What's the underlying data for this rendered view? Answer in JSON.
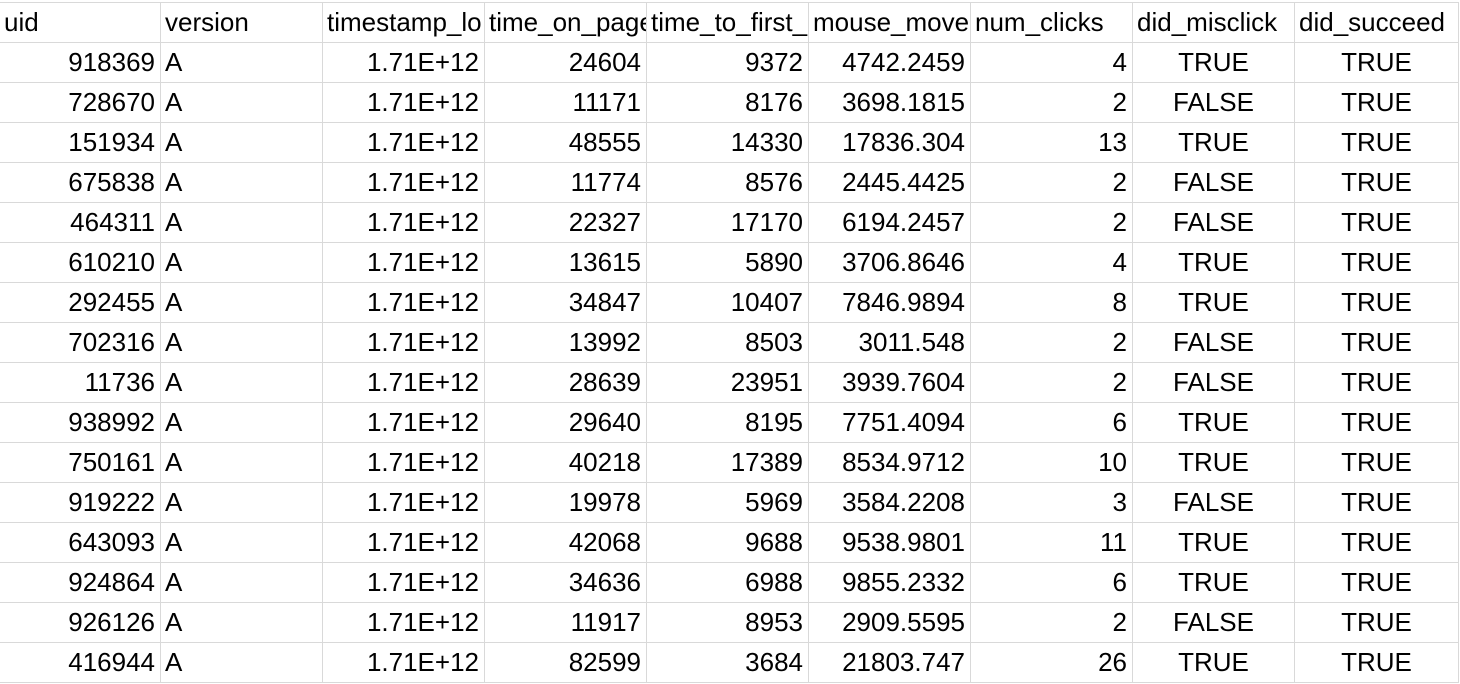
{
  "sheet": {
    "headers": [
      "uid",
      "version",
      "timestamp_lo",
      "time_on_page",
      "time_to_first_",
      "mouse_move",
      "num_clicks",
      "did_misclick",
      "did_succeed"
    ],
    "rows": [
      [
        "918369",
        "A",
        "1.71E+12",
        "24604",
        "9372",
        "4742.2459",
        "4",
        "TRUE",
        "TRUE"
      ],
      [
        "728670",
        "A",
        "1.71E+12",
        "11171",
        "8176",
        "3698.1815",
        "2",
        "FALSE",
        "TRUE"
      ],
      [
        "151934",
        "A",
        "1.71E+12",
        "48555",
        "14330",
        "17836.304",
        "13",
        "TRUE",
        "TRUE"
      ],
      [
        "675838",
        "A",
        "1.71E+12",
        "11774",
        "8576",
        "2445.4425",
        "2",
        "FALSE",
        "TRUE"
      ],
      [
        "464311",
        "A",
        "1.71E+12",
        "22327",
        "17170",
        "6194.2457",
        "2",
        "FALSE",
        "TRUE"
      ],
      [
        "610210",
        "A",
        "1.71E+12",
        "13615",
        "5890",
        "3706.8646",
        "4",
        "TRUE",
        "TRUE"
      ],
      [
        "292455",
        "A",
        "1.71E+12",
        "34847",
        "10407",
        "7846.9894",
        "8",
        "TRUE",
        "TRUE"
      ],
      [
        "702316",
        "A",
        "1.71E+12",
        "13992",
        "8503",
        "3011.548",
        "2",
        "FALSE",
        "TRUE"
      ],
      [
        "11736",
        "A",
        "1.71E+12",
        "28639",
        "23951",
        "3939.7604",
        "2",
        "FALSE",
        "TRUE"
      ],
      [
        "938992",
        "A",
        "1.71E+12",
        "29640",
        "8195",
        "7751.4094",
        "6",
        "TRUE",
        "TRUE"
      ],
      [
        "750161",
        "A",
        "1.71E+12",
        "40218",
        "17389",
        "8534.9712",
        "10",
        "TRUE",
        "TRUE"
      ],
      [
        "919222",
        "A",
        "1.71E+12",
        "19978",
        "5969",
        "3584.2208",
        "3",
        "FALSE",
        "TRUE"
      ],
      [
        "643093",
        "A",
        "1.71E+12",
        "42068",
        "9688",
        "9538.9801",
        "11",
        "TRUE",
        "TRUE"
      ],
      [
        "924864",
        "A",
        "1.71E+12",
        "34636",
        "6988",
        "9855.2332",
        "6",
        "TRUE",
        "TRUE"
      ],
      [
        "926126",
        "A",
        "1.71E+12",
        "11917",
        "8953",
        "2909.5595",
        "2",
        "FALSE",
        "TRUE"
      ],
      [
        "416944",
        "A",
        "1.71E+12",
        "82599",
        "3684",
        "21803.747",
        "26",
        "TRUE",
        "TRUE"
      ]
    ]
  }
}
